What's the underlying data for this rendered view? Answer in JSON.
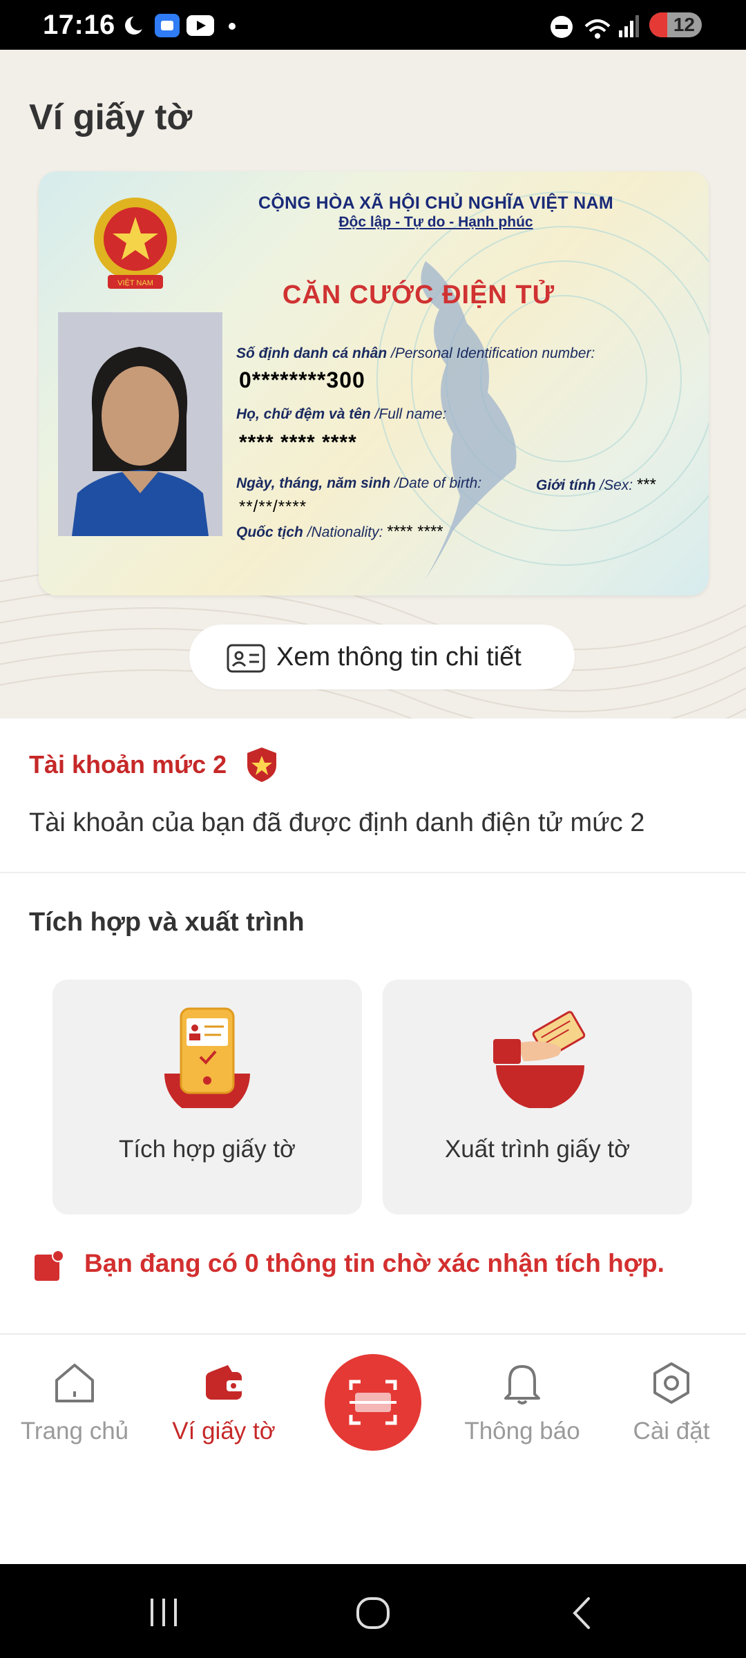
{
  "status_bar": {
    "time": "17:16",
    "battery": "12"
  },
  "page": {
    "title": "Ví giấy tờ"
  },
  "id_card": {
    "header_line1": "CỘNG HÒA XÃ HỘI CHỦ NGHĨA VIỆT NAM",
    "header_line2": "Độc lập - Tự do - Hạnh phúc",
    "card_title": "CĂN CƯỚC ĐIỆN TỬ",
    "emblem_text": "VIỆT NAM",
    "id_label_vi": "Số định danh cá nhân",
    "id_label_en": "/Personal Identification number:",
    "id_value": "0********300",
    "name_label_vi": "Họ, chữ đệm và tên",
    "name_label_en": "/Full name:",
    "name_value": "**** **** ****",
    "dob_label_vi": "Ngày, tháng, năm sinh",
    "dob_label_en": "/Date of birth:",
    "dob_value": "**/**/****",
    "sex_label_vi": "Giới tính",
    "sex_label_en": "/Sex:",
    "sex_value": "***",
    "nat_label_vi": "Quốc tịch",
    "nat_label_en": "/Nationality:",
    "nat_value": "**** ****"
  },
  "detail_button": {
    "label": "Xem thông tin chi tiết"
  },
  "account": {
    "title": "Tài khoản mức 2",
    "description": "Tài khoản của bạn đã được định danh điện tử mức 2"
  },
  "integration": {
    "section_title": "Tích hợp và xuất trình",
    "tiles": [
      {
        "label": "Tích hợp giấy tờ",
        "icon": "phone-document-icon"
      },
      {
        "label": "Xuất trình giấy tờ",
        "icon": "hand-card-icon"
      }
    ],
    "pending_text": "Bạn đang có 0 thông tin chờ xác nhận tích hợp."
  },
  "bottom_nav": {
    "items": [
      {
        "label": "Trang chủ",
        "icon": "home-icon"
      },
      {
        "label": "Ví giấy tờ",
        "icon": "wallet-icon"
      },
      {
        "label": "",
        "icon": "scan-icon"
      },
      {
        "label": "Thông báo",
        "icon": "bell-icon"
      },
      {
        "label": "Cài đặt",
        "icon": "settings-icon"
      }
    ],
    "active_index": 1
  },
  "colors": {
    "brand_red": "#c62828",
    "scan_red": "#e53935",
    "card_title_red": "#d03232",
    "card_text_blue": "#1a2a78"
  }
}
